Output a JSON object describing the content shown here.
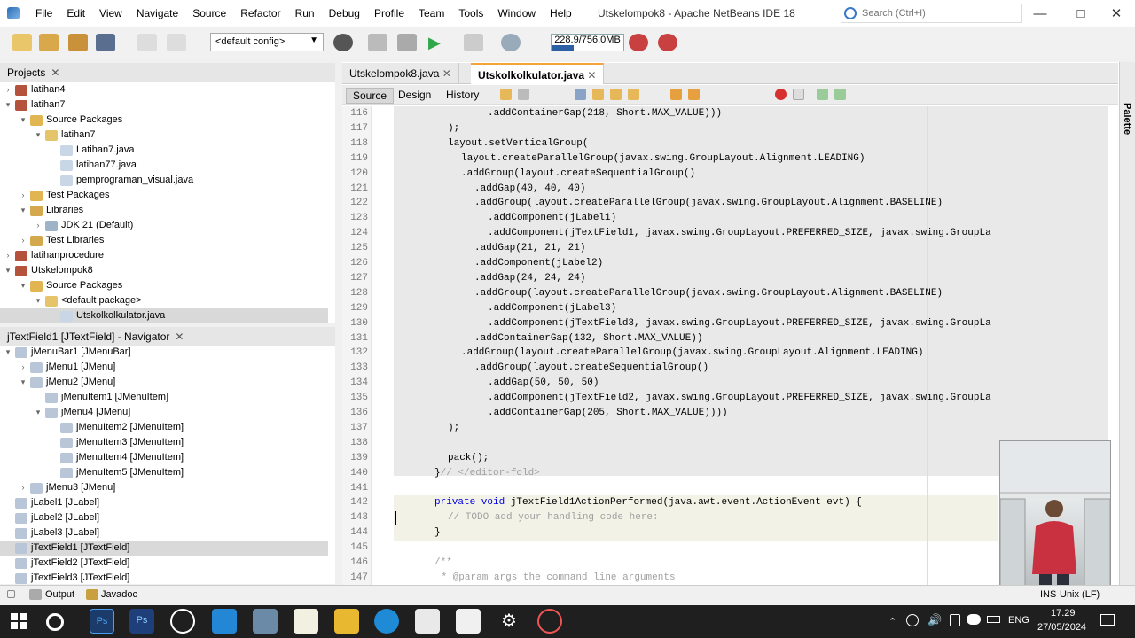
{
  "window": {
    "title": "Utskelompok8 - Apache NetBeans IDE 18",
    "menu": [
      "File",
      "Edit",
      "View",
      "Navigate",
      "Source",
      "Refactor",
      "Run",
      "Debug",
      "Profile",
      "Team",
      "Tools",
      "Window",
      "Help"
    ],
    "search_placeholder": "Search (Ctrl+I)"
  },
  "toolbar": {
    "config": "<default config>",
    "memory": "228.9/756.0MB",
    "memory_fraction": 0.303
  },
  "projects": {
    "title": "Projects",
    "items": [
      {
        "label": "latihan4",
        "level": 1,
        "icon": "project-icon",
        "toggle": ">"
      },
      {
        "label": "latihan7",
        "level": 1,
        "icon": "project-icon",
        "toggle": "v"
      },
      {
        "label": "Source Packages",
        "level": 2,
        "icon": "folder-icon",
        "toggle": "v"
      },
      {
        "label": "latihan7",
        "level": 3,
        "icon": "package-icon",
        "toggle": "v"
      },
      {
        "label": "Latihan7.java",
        "level": 4,
        "icon": "java-file-icon",
        "toggle": ""
      },
      {
        "label": "latihan77.java",
        "level": 4,
        "icon": "java-file-icon",
        "toggle": ""
      },
      {
        "label": "pemprograman_visual.java",
        "level": 4,
        "icon": "java-file-icon",
        "toggle": ""
      },
      {
        "label": "Test Packages",
        "level": 2,
        "icon": "folder-icon",
        "toggle": ">"
      },
      {
        "label": "Libraries",
        "level": 2,
        "icon": "library-icon",
        "toggle": "v"
      },
      {
        "label": "JDK 21 (Default)",
        "level": 3,
        "icon": "jdk-icon",
        "toggle": ">"
      },
      {
        "label": "Test Libraries",
        "level": 2,
        "icon": "library-icon",
        "toggle": ">"
      },
      {
        "label": "latihanprocedure",
        "level": 1,
        "icon": "project-icon",
        "toggle": ">"
      },
      {
        "label": "Utskelompok8",
        "level": 1,
        "icon": "project-icon",
        "toggle": "v"
      },
      {
        "label": "Source Packages",
        "level": 2,
        "icon": "folder-icon",
        "toggle": "v"
      },
      {
        "label": "<default package>",
        "level": 3,
        "icon": "package-icon",
        "toggle": "v"
      },
      {
        "label": "Utskolkolkulator.java",
        "level": 4,
        "icon": "java-file-icon",
        "toggle": "",
        "selected": true
      }
    ]
  },
  "navigator": {
    "title": "jTextField1 [JTextField] - Navigator",
    "items": [
      {
        "label": "jMenuBar1 [JMenuBar]",
        "level": 1,
        "toggle": "v"
      },
      {
        "label": "jMenu1 [JMenu]",
        "level": 2,
        "toggle": ">"
      },
      {
        "label": "jMenu2 [JMenu]",
        "level": 2,
        "toggle": "v"
      },
      {
        "label": "jMenuItem1 [JMenuItem]",
        "level": 3,
        "toggle": ""
      },
      {
        "label": "jMenu4 [JMenu]",
        "level": 3,
        "toggle": "v"
      },
      {
        "label": "jMenuItem2 [JMenuItem]",
        "level": 4,
        "toggle": ""
      },
      {
        "label": "jMenuItem3 [JMenuItem]",
        "level": 4,
        "toggle": ""
      },
      {
        "label": "jMenuItem4 [JMenuItem]",
        "level": 4,
        "toggle": ""
      },
      {
        "label": "jMenuItem5 [JMenuItem]",
        "level": 4,
        "toggle": ""
      },
      {
        "label": "jMenu3 [JMenu]",
        "level": 2,
        "toggle": ">"
      },
      {
        "label": "jLabel1 [JLabel]",
        "level": 1,
        "toggle": ""
      },
      {
        "label": "jLabel2 [JLabel]",
        "level": 1,
        "toggle": ""
      },
      {
        "label": "jLabel3 [JLabel]",
        "level": 1,
        "toggle": ""
      },
      {
        "label": "jTextField1 [JTextField]",
        "level": 1,
        "toggle": "",
        "selected": true
      },
      {
        "label": "jTextField2 [JTextField]",
        "level": 1,
        "toggle": ""
      },
      {
        "label": "jTextField3 [JTextField]",
        "level": 1,
        "toggle": ""
      }
    ]
  },
  "editor": {
    "tabs": [
      {
        "label": "Utskelompok8.java",
        "active": false
      },
      {
        "label": "Utskolkolkulator.java",
        "active": true
      }
    ],
    "modes": [
      "Source",
      "Design",
      "History"
    ],
    "active_mode": "Source",
    "lines": [
      {
        "n": "116",
        "indent": 10,
        "parts": [
          {
            "t": ".addContainerGap(218, Short.MAX_VALUE)))"
          }
        ]
      },
      {
        "n": "117",
        "indent": 4,
        "parts": [
          {
            "t": ");"
          }
        ]
      },
      {
        "n": "118",
        "indent": 4,
        "parts": [
          {
            "t": "layout.setVerticalGroup("
          }
        ]
      },
      {
        "n": "119",
        "indent": 6,
        "parts": [
          {
            "t": "layout.createParallelGroup(javax.swing.GroupLayout.Alignment.LEADING)"
          }
        ]
      },
      {
        "n": "120",
        "indent": 6,
        "parts": [
          {
            "t": ".addGroup(layout.createSequentialGroup()"
          }
        ]
      },
      {
        "n": "121",
        "indent": 8,
        "parts": [
          {
            "t": ".addGap(40, 40, 40)"
          }
        ]
      },
      {
        "n": "122",
        "indent": 8,
        "parts": [
          {
            "t": ".addGroup(layout.createParallelGroup(javax.swing.GroupLayout.Alignment.BASELINE)"
          }
        ]
      },
      {
        "n": "123",
        "indent": 10,
        "parts": [
          {
            "t": ".addComponent(jLabel1)"
          }
        ]
      },
      {
        "n": "124",
        "indent": 10,
        "parts": [
          {
            "t": ".addComponent(jTextField1, javax.swing.GroupLayout.PREFERRED_SIZE, javax.swing.GroupLa"
          }
        ]
      },
      {
        "n": "125",
        "indent": 8,
        "parts": [
          {
            "t": ".addGap(21, 21, 21)"
          }
        ]
      },
      {
        "n": "126",
        "indent": 8,
        "parts": [
          {
            "t": ".addComponent(jLabel2)"
          }
        ]
      },
      {
        "n": "127",
        "indent": 8,
        "parts": [
          {
            "t": ".addGap(24, 24, 24)"
          }
        ]
      },
      {
        "n": "128",
        "indent": 8,
        "parts": [
          {
            "t": ".addGroup(layout.createParallelGroup(javax.swing.GroupLayout.Alignment.BASELINE)"
          }
        ]
      },
      {
        "n": "129",
        "indent": 10,
        "parts": [
          {
            "t": ".addComponent(jLabel3)"
          }
        ]
      },
      {
        "n": "130",
        "indent": 10,
        "parts": [
          {
            "t": ".addComponent(jTextField3, javax.swing.GroupLayout.PREFERRED_SIZE, javax.swing.GroupLa"
          }
        ]
      },
      {
        "n": "131",
        "indent": 8,
        "parts": [
          {
            "t": ".addContainerGap(132, Short.MAX_VALUE))"
          }
        ]
      },
      {
        "n": "132",
        "indent": 6,
        "parts": [
          {
            "t": ".addGroup(layout.createParallelGroup(javax.swing.GroupLayout.Alignment.LEADING)"
          }
        ]
      },
      {
        "n": "133",
        "indent": 8,
        "parts": [
          {
            "t": ".addGroup(layout.createSequentialGroup()"
          }
        ]
      },
      {
        "n": "134",
        "indent": 10,
        "parts": [
          {
            "t": ".addGap(50, 50, 50)"
          }
        ]
      },
      {
        "n": "135",
        "indent": 10,
        "parts": [
          {
            "t": ".addComponent(jTextField2, javax.swing.GroupLayout.PREFERRED_SIZE, javax.swing.GroupLa"
          }
        ]
      },
      {
        "n": "136",
        "indent": 10,
        "parts": [
          {
            "t": ".addContainerGap(205, Short.MAX_VALUE))))"
          }
        ]
      },
      {
        "n": "137",
        "indent": 4,
        "parts": [
          {
            "t": ");"
          }
        ]
      },
      {
        "n": "138",
        "indent": 0,
        "parts": [
          {
            "t": ""
          }
        ]
      },
      {
        "n": "139",
        "indent": 4,
        "parts": [
          {
            "t": "pack();"
          }
        ]
      },
      {
        "n": "140",
        "indent": 2,
        "parts": [
          {
            "t": "}"
          },
          {
            "t": "// </editor-fold>",
            "c": "fold"
          }
        ]
      },
      {
        "n": "141",
        "indent": 0,
        "parts": [
          {
            "t": ""
          }
        ]
      },
      {
        "n": "142",
        "indent": 2,
        "parts": [
          {
            "t": "private void ",
            "c": "kw"
          },
          {
            "t": "jTextField1ActionPerformed(java.awt.event.ActionEvent evt) {"
          }
        ]
      },
      {
        "n": "143",
        "indent": 4,
        "parts": [
          {
            "t": "// TODO add your handling code here:",
            "c": "cm"
          }
        ]
      },
      {
        "n": "144",
        "indent": 2,
        "parts": [
          {
            "t": "}"
          }
        ]
      },
      {
        "n": "145",
        "indent": 0,
        "parts": [
          {
            "t": ""
          }
        ]
      },
      {
        "n": "146",
        "indent": 2,
        "parts": [
          {
            "t": "/**",
            "c": "cm"
          }
        ]
      },
      {
        "n": "147",
        "indent": 3,
        "parts": [
          {
            "t": "* @param args the command line arguments",
            "c": "cm"
          }
        ]
      }
    ]
  },
  "palette_label": "Palette",
  "status": {
    "output": "Output",
    "javadoc": "Javadoc",
    "insert_mode": "INS",
    "line_ending": "Unix (LF)"
  },
  "taskbar": {
    "lang": "ENG",
    "time": "17.29",
    "date": "27/05/2024"
  }
}
